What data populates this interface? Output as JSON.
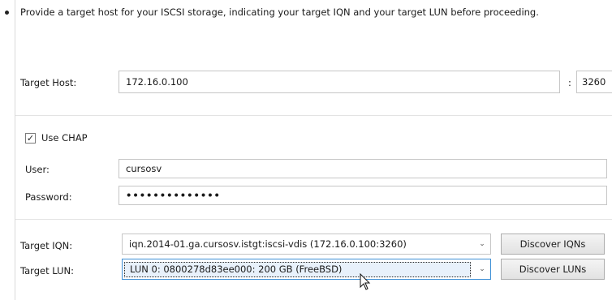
{
  "intro_text": "Provide a target host for your ISCSI storage, indicating your target IQN and your target LUN before proceeding.",
  "target_host": {
    "label": "Target Host:",
    "value": "172.16.0.100",
    "port_separator": ":",
    "port": "3260"
  },
  "chap": {
    "label": "Use CHAP",
    "checked": true,
    "check_glyph": "✓"
  },
  "user": {
    "label": "User:",
    "value": "cursosv"
  },
  "password": {
    "label": "Password:",
    "masked_value": "••••••••••••••"
  },
  "target_iqn": {
    "label": "Target IQN:",
    "selected": "iqn.2014-01.ga.cursosv.istgt:iscsi-vdis (172.16.0.100:3260)",
    "arrow": "⌄",
    "button": "Discover IQNs"
  },
  "target_lun": {
    "label": "Target LUN:",
    "selected": "LUN 0: 0800278d83ee000: 200 GB (FreeBSD)",
    "arrow": "⌄",
    "button": "Discover LUNs"
  },
  "colors": {
    "focus_border": "#3c8fd6",
    "field_border": "#c6c6c6",
    "button_border": "#adadad"
  },
  "icons": [
    "chevron-down-icon",
    "mouse-pointer-icon",
    "checkmark-icon"
  ]
}
